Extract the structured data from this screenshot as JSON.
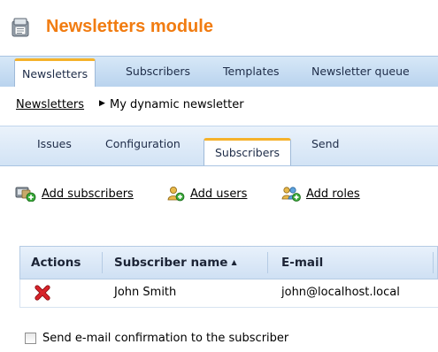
{
  "header": {
    "title": "Newsletters module",
    "icon": "newsletter-module-icon",
    "title_color": "#f17c11"
  },
  "top_tabs": [
    {
      "label": "Newsletters",
      "active": true
    },
    {
      "label": "Subscribers",
      "active": false
    },
    {
      "label": "Templates",
      "active": false
    },
    {
      "label": "Newsletter queue",
      "active": false
    }
  ],
  "breadcrumb": {
    "link": "Newsletters",
    "separator": "▶",
    "current": "My dynamic newsletter"
  },
  "sub_tabs": [
    {
      "label": "Issues",
      "active": false
    },
    {
      "label": "Configuration",
      "active": false
    },
    {
      "label": "Subscribers",
      "active": true
    },
    {
      "label": "Send",
      "active": false
    }
  ],
  "actions": {
    "add_subscribers": {
      "label": "Add subscribers",
      "icon": "add-subscribers-icon"
    },
    "add_users": {
      "label": "Add users",
      "icon": "add-users-icon"
    },
    "add_roles": {
      "label": "Add roles",
      "icon": "add-roles-icon"
    }
  },
  "grid": {
    "columns": [
      "Actions",
      "Subscriber name",
      "E-mail"
    ],
    "sort_column": "Subscriber name",
    "sort_direction": "ascending",
    "sort_indicator": "▲",
    "rows": [
      {
        "action_icon": "delete-icon",
        "name": "John Smith",
        "email": "john@localhost.local"
      }
    ]
  },
  "confirmation": {
    "label": "Send e-mail confirmation to the subscriber",
    "checked": false
  },
  "colors": {
    "accent_orange": "#f5b22b",
    "tab_bar_blue": "#b9d3ee",
    "delete_red": "#c8161d"
  }
}
